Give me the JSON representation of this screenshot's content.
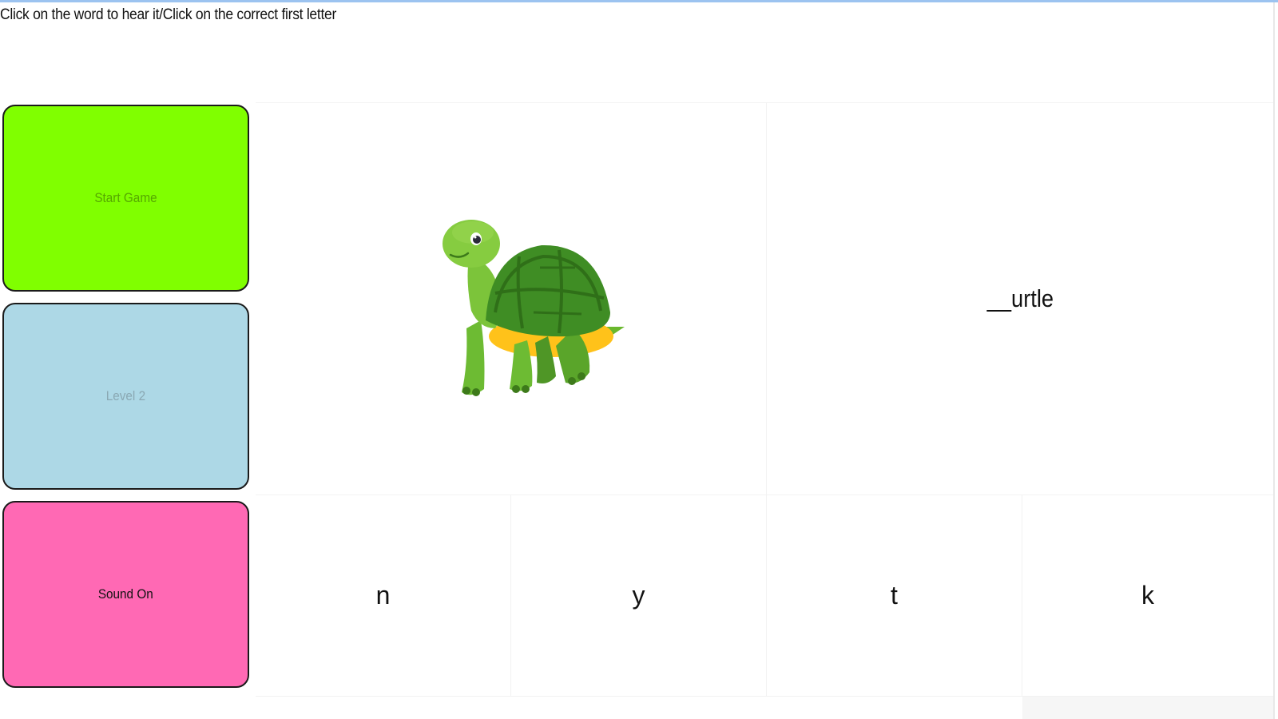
{
  "instructions": "Click on the word to hear it/Click on the correct first letter",
  "buttons": {
    "start": "Start Game",
    "level": "Level 2",
    "sound": "Sound On"
  },
  "word": "__urtle",
  "letters": [
    "n",
    "y",
    "t",
    "k"
  ],
  "picture_icon": "turtle-icon",
  "colors": {
    "start_bg": "#80ff00",
    "level_bg": "#add8e6",
    "sound_bg": "#ff69b4",
    "top_accent": "#9cc3f0"
  }
}
